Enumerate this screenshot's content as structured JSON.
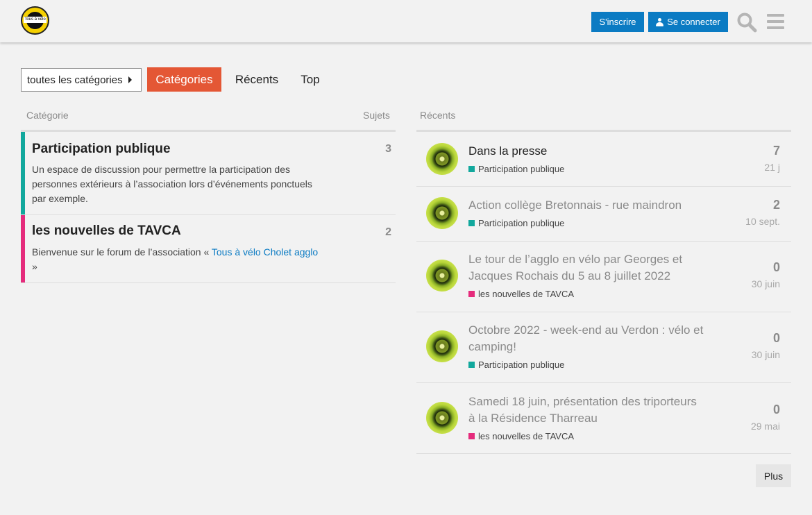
{
  "header": {
    "logo_text": "Tous à vélo",
    "signup_label": "S'inscrire",
    "login_label": "Se connecter",
    "primary_color": "#0b7bc3"
  },
  "nav": {
    "dropdown_label": "toutes les catégories",
    "tabs": [
      {
        "label": "Catégories",
        "active": true
      },
      {
        "label": "Récents",
        "active": false
      },
      {
        "label": "Top",
        "active": false
      }
    ],
    "active_color": "#e45735"
  },
  "categories": {
    "header_category": "Catégorie",
    "header_topics": "Sujets",
    "items": [
      {
        "name": "Participation publique",
        "description": "Un espace de discussion pour permettre la participation des personnes extérieurs à l’association lors d’événements ponctuels par exemple.",
        "count": "3",
        "color": "#12a89d"
      },
      {
        "name": "les nouvelles de TAVCA",
        "description_before": "Bienvenue sur le forum de l’association « ",
        "description_link": "Tous à vélo Cholet agglo",
        "description_after": " »",
        "count": "2",
        "color": "#e52b7c"
      }
    ]
  },
  "recent": {
    "header": "Récents",
    "topics": [
      {
        "title": "Dans la presse",
        "category": "Participation publique",
        "category_color": "#12a89d",
        "posts": "7",
        "date": "21 j",
        "unread": true
      },
      {
        "title": "Action collège Bretonnais - rue maindron",
        "category": "Participation publique",
        "category_color": "#12a89d",
        "posts": "2",
        "date": "10 sept.",
        "unread": false
      },
      {
        "title": "Le tour de l’agglo en vélo par Georges et Jacques Rochais du 5 au 8 juillet 2022",
        "category": "les nouvelles de TAVCA",
        "category_color": "#e52b7c",
        "posts": "0",
        "date": "30 juin",
        "unread": false
      },
      {
        "title": "Octobre 2022 - week-end au Verdon : vélo et camping!",
        "category": "Participation publique",
        "category_color": "#12a89d",
        "posts": "0",
        "date": "30 juin",
        "unread": false
      },
      {
        "title": "Samedi 18 juin, présentation des triporteurs à la Résidence Tharreau",
        "category": "les nouvelles de TAVCA",
        "category_color": "#e52b7c",
        "posts": "0",
        "date": "29 mai",
        "unread": false
      }
    ],
    "more_label": "Plus"
  }
}
